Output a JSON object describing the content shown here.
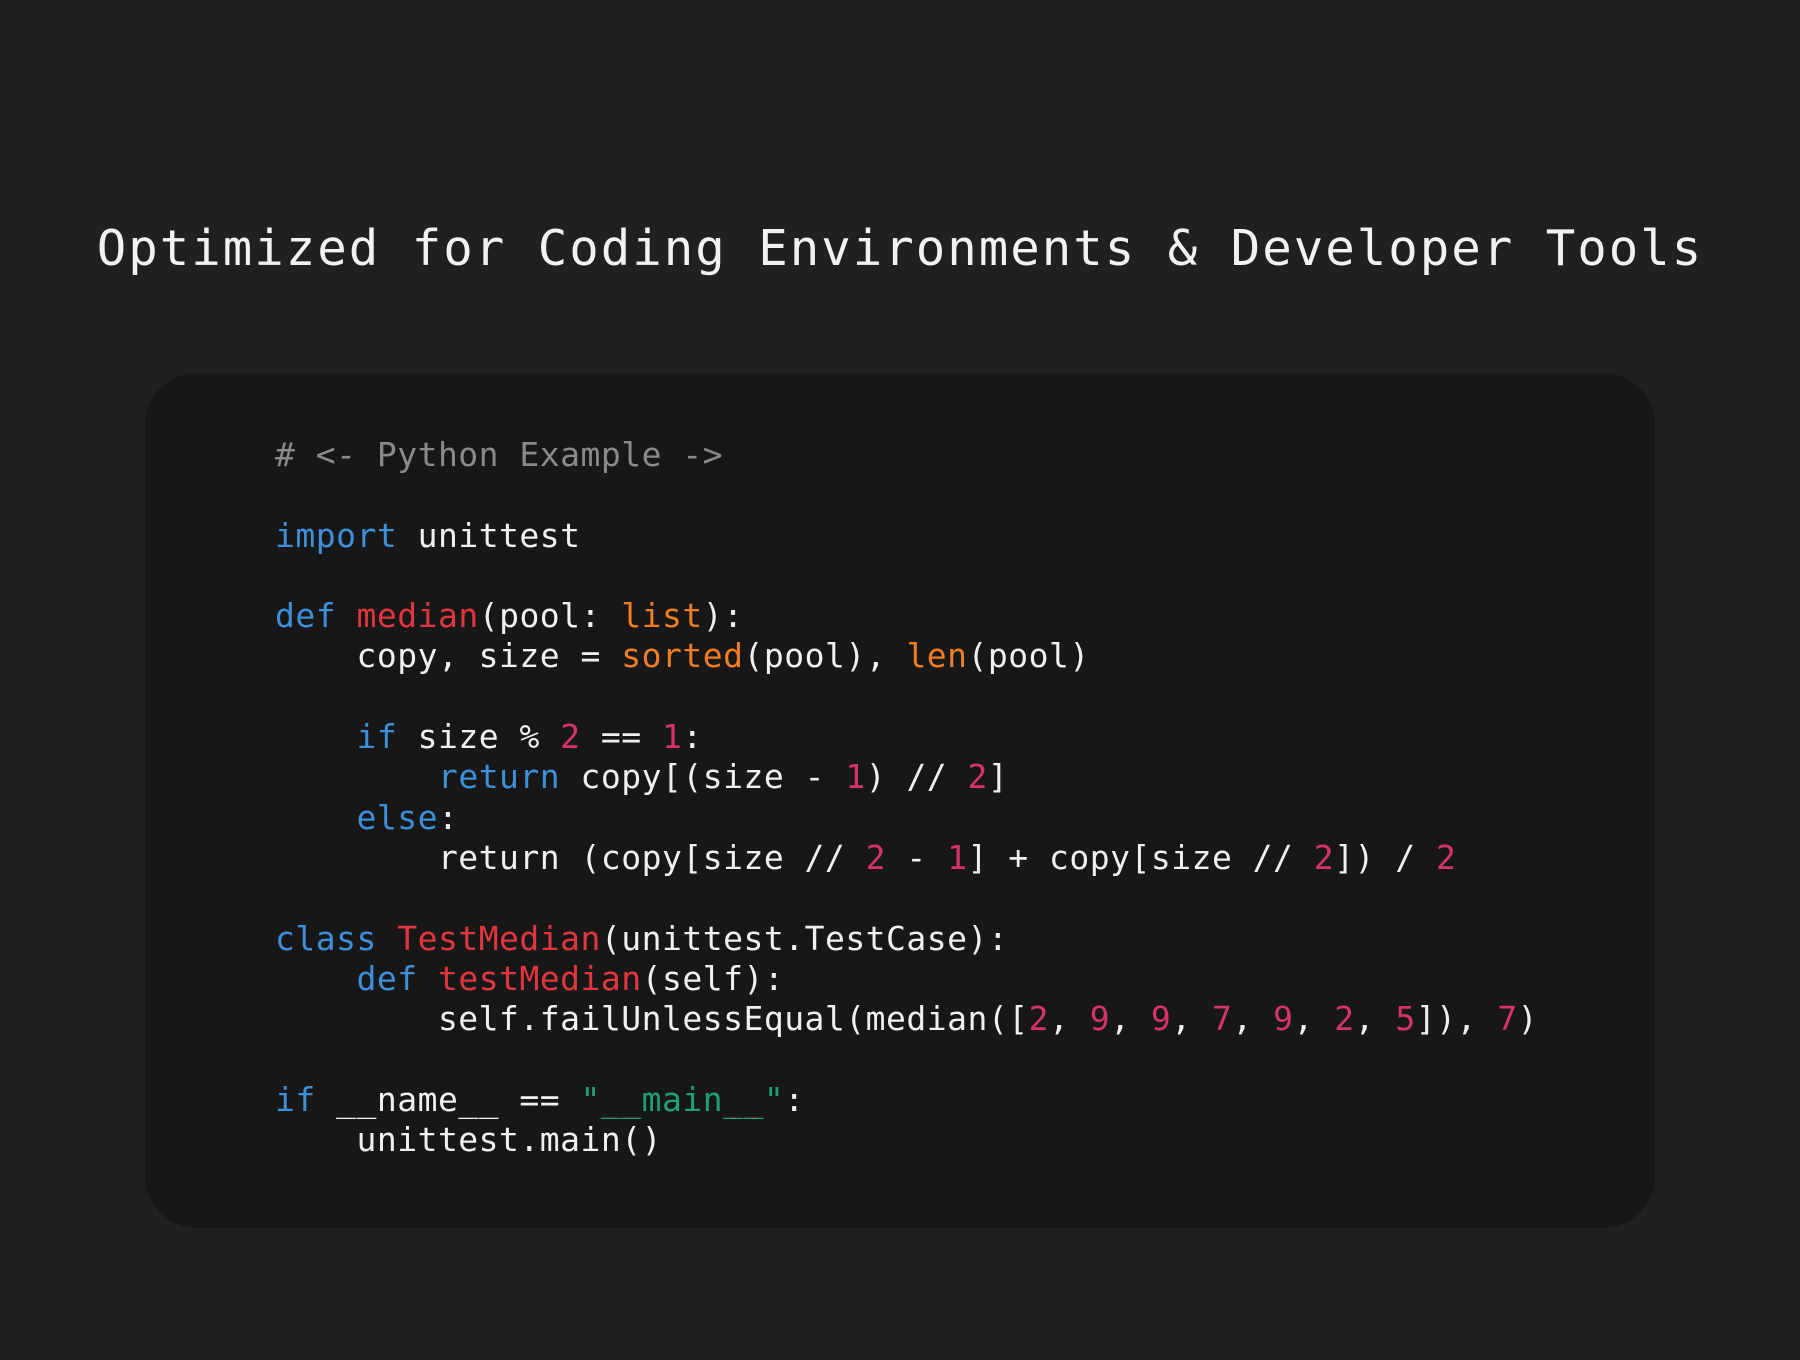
{
  "headline": "Optimized for Coding Environments & Developer Tools",
  "colors": {
    "background": "#202020",
    "card": "#171717",
    "text": "#f0f0f0",
    "comment": "#8a8a8a",
    "keyword": "#3c8fd8",
    "function_name": "#e2363e",
    "builtin": "#ef7d22",
    "number": "#d6336e",
    "string": "#1e9e76"
  },
  "code": {
    "language": "Python",
    "lines": [
      [
        {
          "t": "comment",
          "v": "# <- Python Example ->"
        }
      ],
      [],
      [
        {
          "t": "keyword",
          "v": "import"
        },
        {
          "t": "plain",
          "v": " unittest"
        }
      ],
      [],
      [
        {
          "t": "keyword",
          "v": "def"
        },
        {
          "t": "plain",
          "v": " "
        },
        {
          "t": "func",
          "v": "median"
        },
        {
          "t": "plain",
          "v": "(pool: "
        },
        {
          "t": "builtin",
          "v": "list"
        },
        {
          "t": "plain",
          "v": "):"
        }
      ],
      [
        {
          "t": "plain",
          "v": "    copy, size = "
        },
        {
          "t": "builtin",
          "v": "sorted"
        },
        {
          "t": "plain",
          "v": "(pool), "
        },
        {
          "t": "builtin",
          "v": "len"
        },
        {
          "t": "plain",
          "v": "(pool)"
        }
      ],
      [],
      [
        {
          "t": "plain",
          "v": "    "
        },
        {
          "t": "keyword",
          "v": "if"
        },
        {
          "t": "plain",
          "v": " size % "
        },
        {
          "t": "number",
          "v": "2"
        },
        {
          "t": "plain",
          "v": " == "
        },
        {
          "t": "number",
          "v": "1"
        },
        {
          "t": "plain",
          "v": ":"
        }
      ],
      [
        {
          "t": "plain",
          "v": "        "
        },
        {
          "t": "keyword",
          "v": "return"
        },
        {
          "t": "plain",
          "v": " copy[(size - "
        },
        {
          "t": "number",
          "v": "1"
        },
        {
          "t": "plain",
          "v": ") // "
        },
        {
          "t": "number",
          "v": "2"
        },
        {
          "t": "plain",
          "v": "]"
        }
      ],
      [
        {
          "t": "plain",
          "v": "    "
        },
        {
          "t": "keyword",
          "v": "else"
        },
        {
          "t": "plain",
          "v": ":"
        }
      ],
      [
        {
          "t": "plain",
          "v": "        return (copy[size // "
        },
        {
          "t": "number",
          "v": "2"
        },
        {
          "t": "plain",
          "v": " - "
        },
        {
          "t": "number",
          "v": "1"
        },
        {
          "t": "plain",
          "v": "] + copy[size // "
        },
        {
          "t": "number",
          "v": "2"
        },
        {
          "t": "plain",
          "v": "]) / "
        },
        {
          "t": "number",
          "v": "2"
        }
      ],
      [],
      [
        {
          "t": "keyword",
          "v": "class"
        },
        {
          "t": "plain",
          "v": " "
        },
        {
          "t": "func",
          "v": "TestMedian"
        },
        {
          "t": "plain",
          "v": "(unittest.TestCase):"
        }
      ],
      [
        {
          "t": "plain",
          "v": "    "
        },
        {
          "t": "keyword",
          "v": "def"
        },
        {
          "t": "plain",
          "v": " "
        },
        {
          "t": "func",
          "v": "testMedian"
        },
        {
          "t": "plain",
          "v": "(self):"
        }
      ],
      [
        {
          "t": "plain",
          "v": "        self.failUnlessEqual(median(["
        },
        {
          "t": "number",
          "v": "2"
        },
        {
          "t": "plain",
          "v": ", "
        },
        {
          "t": "number",
          "v": "9"
        },
        {
          "t": "plain",
          "v": ", "
        },
        {
          "t": "number",
          "v": "9"
        },
        {
          "t": "plain",
          "v": ", "
        },
        {
          "t": "number",
          "v": "7"
        },
        {
          "t": "plain",
          "v": ", "
        },
        {
          "t": "number",
          "v": "9"
        },
        {
          "t": "plain",
          "v": ", "
        },
        {
          "t": "number",
          "v": "2"
        },
        {
          "t": "plain",
          "v": ", "
        },
        {
          "t": "number",
          "v": "5"
        },
        {
          "t": "plain",
          "v": "]), "
        },
        {
          "t": "number",
          "v": "7"
        },
        {
          "t": "plain",
          "v": ")"
        }
      ],
      [],
      [
        {
          "t": "keyword",
          "v": "if"
        },
        {
          "t": "plain",
          "v": " __name__ == "
        },
        {
          "t": "string",
          "v": "\"__main__\""
        },
        {
          "t": "plain",
          "v": ":"
        }
      ],
      [
        {
          "t": "plain",
          "v": "    unittest.main()"
        }
      ]
    ]
  }
}
